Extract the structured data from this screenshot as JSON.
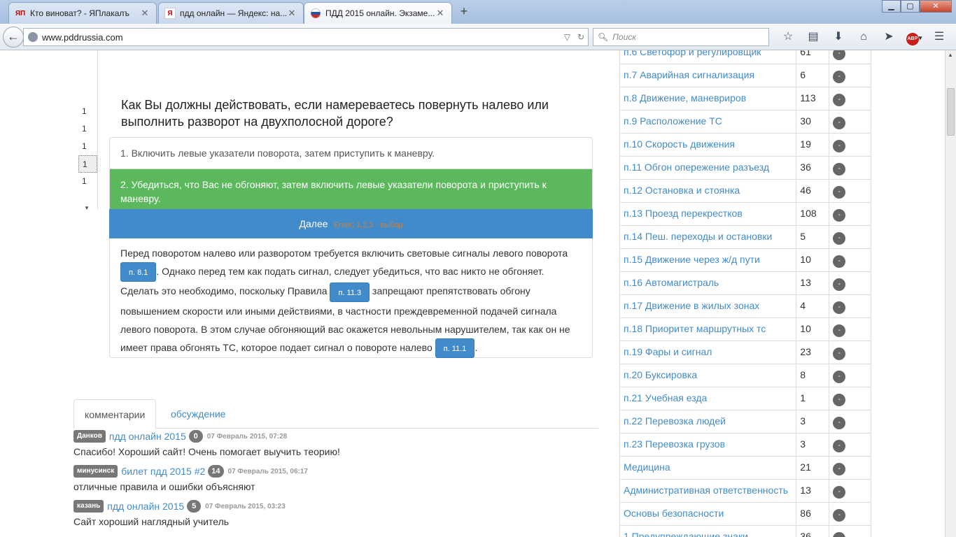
{
  "browser": {
    "tabs": [
      {
        "favicon": "ЯП",
        "title": "Кто виноват? - ЯПлакалъ"
      },
      {
        "favicon": "Я",
        "title": "пдд онлайн — Яндекс: на..."
      },
      {
        "favicon": "flag-ru",
        "title": "ПДД 2015 онлайн. Экзаме..."
      }
    ],
    "url": "www.pddrussia.com",
    "search_placeholder": "Поиск",
    "window_buttons": {
      "minimize": "▁",
      "maximize": "▢",
      "close": "✕"
    }
  },
  "left_list": [
    "",
    "",
    "",
    "1",
    "1",
    "1",
    "1",
    "1"
  ],
  "quiz": {
    "question": "Как Вы должны действовать, если намереваетесь повернуть налево или выполнить разворот на двухполосной дороге?",
    "answers": [
      {
        "text": "1. Включить левые указатели поворота, затем приступить к маневру.",
        "correct": false
      },
      {
        "text": "2. Убедиться, что Вас не обгоняют, затем включить левые указатели поворота и приступить к маневру.",
        "correct": true
      }
    ],
    "next_label": "Далее",
    "next_hint": "Enter; 1,2,3 - выбор",
    "explanation": {
      "part1": "Перед поворотом налево или разворотом требуется включить световые сигналы левого поворота",
      "rule1": "п. 8.1",
      "part2": ". Однако перед тем как подать сигнал, следует убедиться, что вас никто не обгоняет. Сделать это необходимо, поскольку Правила",
      "rule2": "п. 11.3",
      "part3": "запрещают препятствовать обгону повышением скорости или иными действиями, в частности преждевременной подачей сигнала левого поворота. В этом случае обгоняющий вас окажется невольным нарушителем, так как он не имеет права обгонять ТС, которое подает сигнал о повороте налево",
      "rule3": "п. 11.1",
      "part4": "."
    }
  },
  "comments_tabs": {
    "active": "комментарии",
    "other": "обсуждение"
  },
  "comments": [
    {
      "user": "Данков",
      "topic": "пдд онлайн 2015",
      "count": "0",
      "date": "07 Февраль 2015, 07:28",
      "text": "Спасибо! Хороший сайт! Очень помогает выучить теорию!"
    },
    {
      "user": "минусинск",
      "topic": "билет пдд 2015 #2",
      "count": "14",
      "date": "07 Февраль 2015, 06:17",
      "text": "отличные правила и ошибки объясняют"
    },
    {
      "user": "казань",
      "topic": "пдд онлайн 2015",
      "count": "5",
      "date": "07 Февраль 2015, 03:23",
      "text": "Сайт хороший наглядный учитель"
    }
  ],
  "sections": [
    {
      "name": "п.6 Светофор и регулировщик",
      "count": "61"
    },
    {
      "name": "п.7 Аварийная сигнализация",
      "count": "6"
    },
    {
      "name": "п.8 Движение, маневриров",
      "count": "113"
    },
    {
      "name": "п.9 Расположение ТС",
      "count": "30"
    },
    {
      "name": "п.10 Скорость движения",
      "count": "19"
    },
    {
      "name": "п.11 Обгон опережение разъезд",
      "count": "36"
    },
    {
      "name": "п.12 Остановка и стоянка",
      "count": "46"
    },
    {
      "name": "п.13 Проезд перекрестков",
      "count": "108"
    },
    {
      "name": "п.14 Пеш. переходы и остановки",
      "count": "5"
    },
    {
      "name": "п.15 Движение через ж/д пути",
      "count": "10"
    },
    {
      "name": "п.16 Автомагистраль",
      "count": "13"
    },
    {
      "name": "п.17 Движение в жилых зонах",
      "count": "4"
    },
    {
      "name": "п.18 Приоритет маршрутных тс",
      "count": "10"
    },
    {
      "name": "п.19 Фары и сигнал",
      "count": "23"
    },
    {
      "name": "п.20 Буксировка",
      "count": "8"
    },
    {
      "name": "п.21 Учебная езда",
      "count": "1"
    },
    {
      "name": "п.22 Перевозка людей",
      "count": "3"
    },
    {
      "name": "п.23 Перевозка грузов",
      "count": "3"
    },
    {
      "name": "Медицина",
      "count": "21"
    },
    {
      "name": "Административная ответственность",
      "count": "13"
    },
    {
      "name": "Основы безопасности",
      "count": "86"
    },
    {
      "name": "1.Предупреждающие знаки",
      "count": "36"
    }
  ],
  "section_button_label": "-",
  "colors": {
    "primary": "#428bca",
    "success": "#5cb85c",
    "badge": "#777777"
  }
}
